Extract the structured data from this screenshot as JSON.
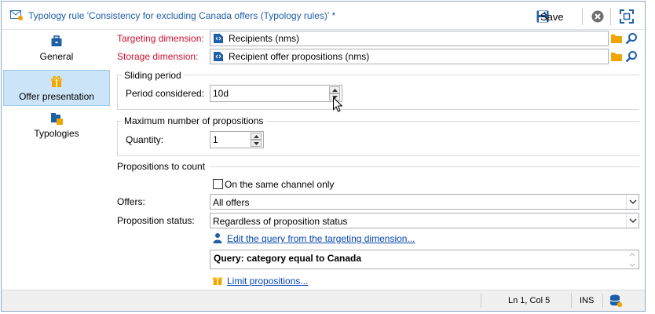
{
  "window": {
    "title": "Typology rule 'Consistency for excluding Canada offers (Typology rules)' *",
    "save_label": "Save"
  },
  "nav": {
    "items": [
      {
        "label": "General",
        "icon": "briefcase-icon"
      },
      {
        "label": "Offer presentation",
        "icon": "gift-icon",
        "active": true
      },
      {
        "label": "Typologies",
        "icon": "typologies-icon"
      }
    ]
  },
  "form": {
    "targeting_label": "Targeting dimension:",
    "targeting_value": "Recipients (nms)",
    "storage_label": "Storage dimension:",
    "storage_value": "Recipient offer propositions (nms)",
    "sliding_title": "Sliding period",
    "period_label": "Period considered:",
    "period_value": "10d",
    "max_title": "Maximum number of propositions",
    "quantity_label": "Quantity:",
    "quantity_value": "1",
    "propositions_title": "Propositions to count",
    "same_channel_label": "On the same channel only",
    "same_channel_checked": false,
    "offers_label": "Offers:",
    "offers_value": "All offers",
    "status_label": "Proposition status:",
    "status_value": "Regardless of proposition status",
    "edit_query_link": "Edit the query from the targeting dimension...",
    "query_text": "Query: category equal to Canada",
    "limit_link": "Limit propositions..."
  },
  "statusbar": {
    "position": "Ln 1, Col 5",
    "mode": "INS"
  },
  "colors": {
    "accent": "#1f5fa8",
    "required_label": "#c8102e",
    "nav_active_bg": "#cce4f7",
    "link": "#0645ad"
  }
}
